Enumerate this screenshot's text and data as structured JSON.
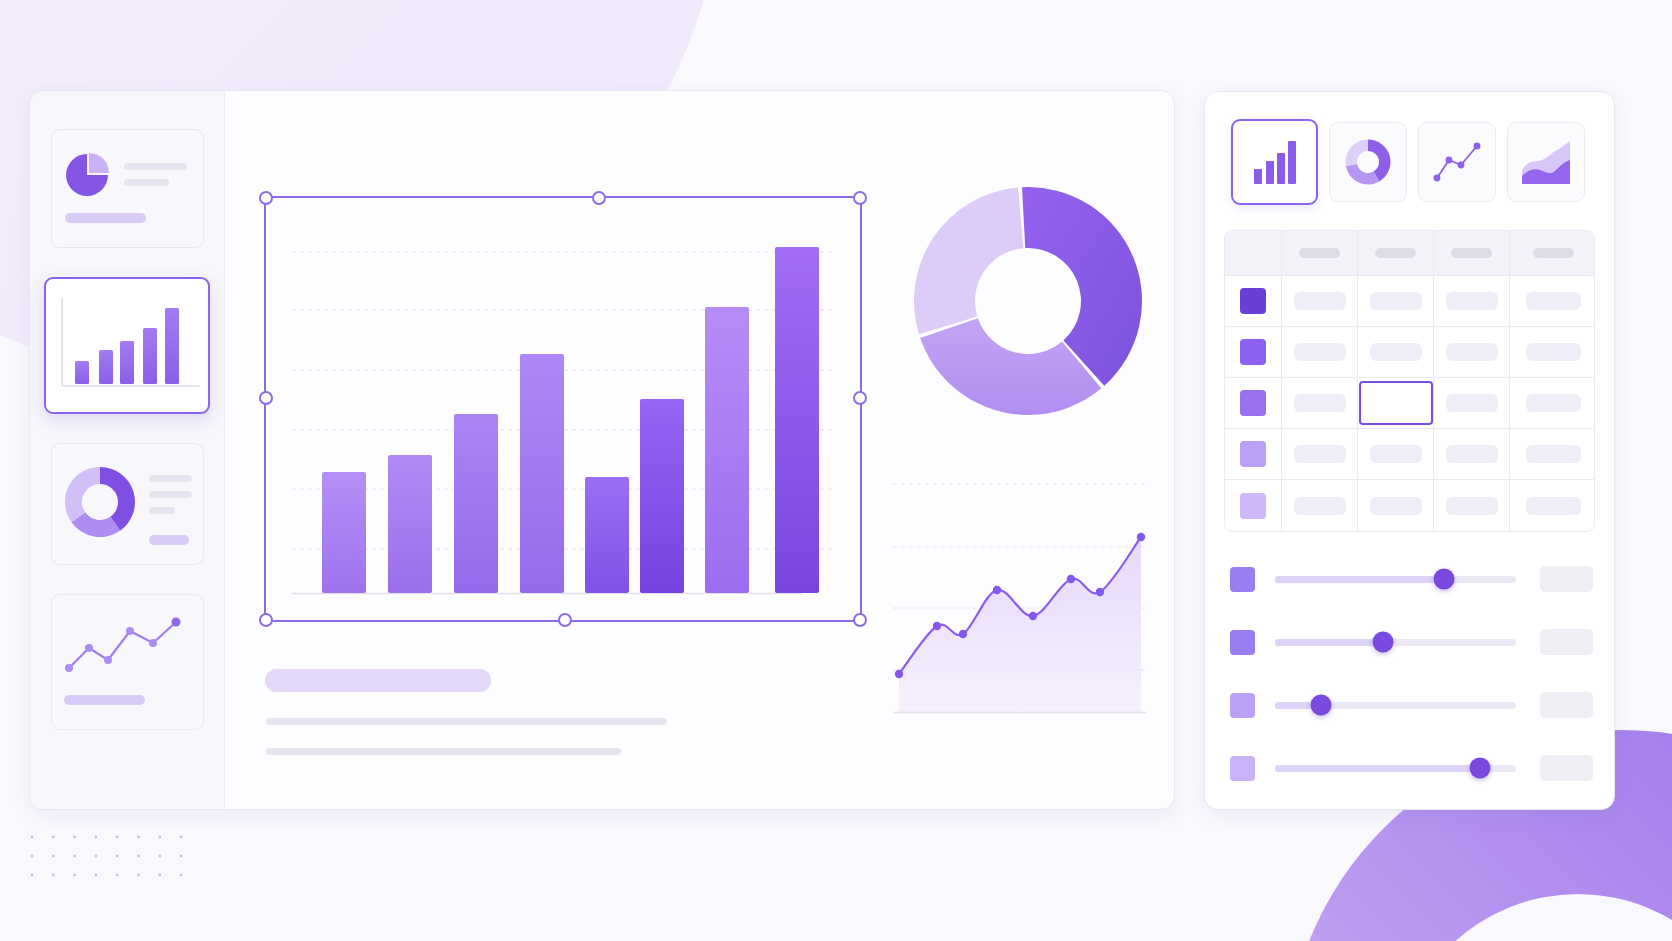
{
  "sidebar": {
    "thumbnails": [
      {
        "kind": "pie",
        "selected": false
      },
      {
        "kind": "bar",
        "selected": true
      },
      {
        "kind": "donut",
        "selected": false
      },
      {
        "kind": "line",
        "selected": false
      }
    ]
  },
  "canvas": {
    "bar_chart": {
      "selected": true
    }
  },
  "panel": {
    "chart_types": [
      {
        "kind": "bar",
        "selected": true
      },
      {
        "kind": "donut",
        "selected": false
      },
      {
        "kind": "line",
        "selected": false
      },
      {
        "kind": "area",
        "selected": false
      }
    ],
    "table": {
      "rows": [
        {
          "color": "#6a3fd8",
          "cells": [
            {
              "selected": false
            },
            {
              "selected": false
            },
            {
              "selected": false
            },
            {
              "selected": false
            }
          ]
        },
        {
          "color": "#8b62ee",
          "cells": [
            {
              "selected": false
            },
            {
              "selected": false
            },
            {
              "selected": false
            },
            {
              "selected": false
            }
          ]
        },
        {
          "color": "#9870f0",
          "cells": [
            {
              "selected": false
            },
            {
              "selected": true
            },
            {
              "selected": false
            },
            {
              "selected": false
            }
          ]
        },
        {
          "color": "#bb9ef5",
          "cells": [
            {
              "selected": false
            },
            {
              "selected": false
            },
            {
              "selected": false
            },
            {
              "selected": false
            }
          ]
        },
        {
          "color": "#d0b8f8",
          "cells": [
            {
              "selected": false
            },
            {
              "selected": false
            },
            {
              "selected": false
            },
            {
              "selected": false
            }
          ]
        }
      ]
    },
    "sliders": [
      {
        "color": "#9a7cf3",
        "level": 0.7
      },
      {
        "color": "#9a7cf3",
        "level": 0.45
      },
      {
        "color": "#bba0f6",
        "level": 0.19
      },
      {
        "color": "#c9b2f8",
        "level": 0.85
      }
    ]
  }
}
